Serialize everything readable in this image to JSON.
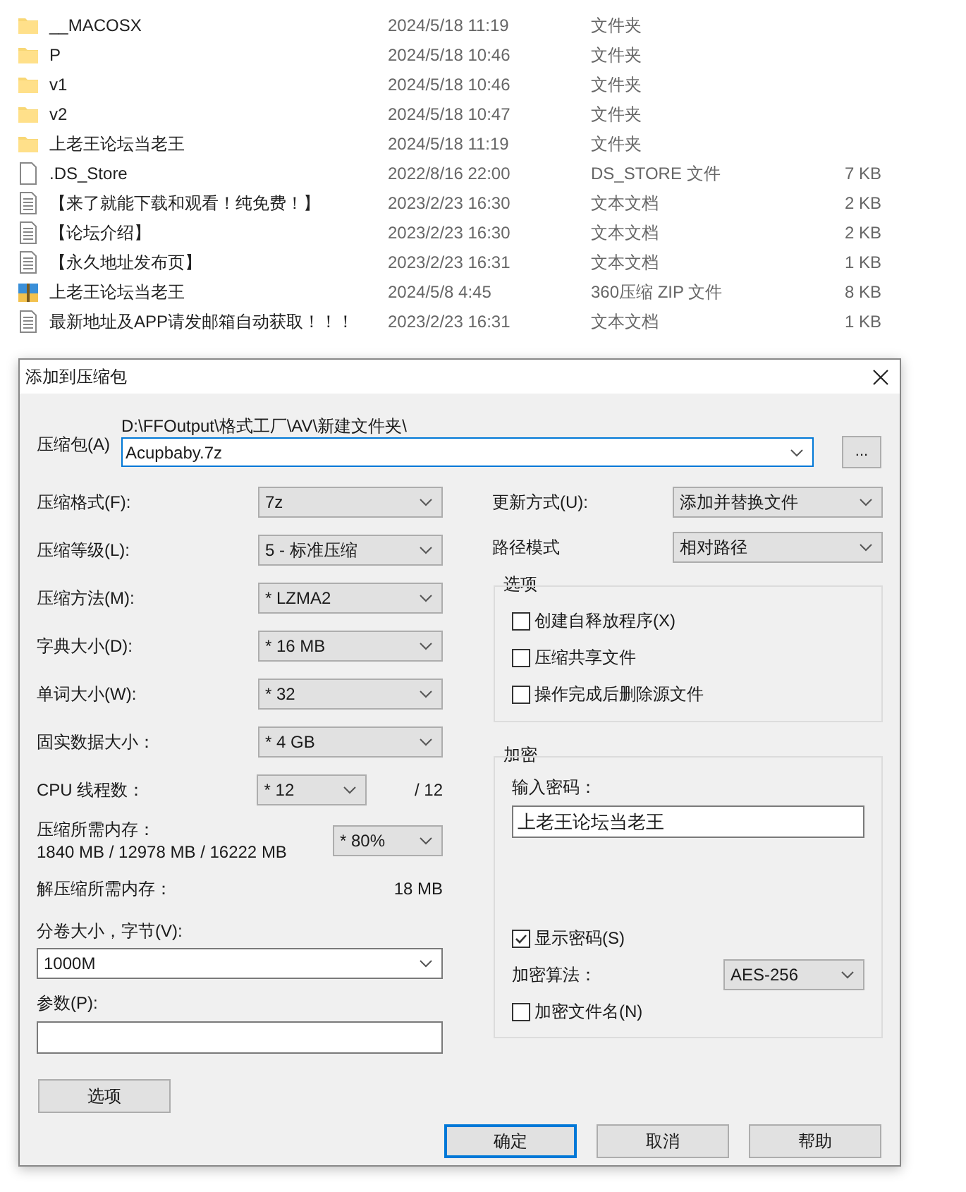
{
  "file_list": {
    "rows": [
      {
        "kind": "folder",
        "name": "__MACOSX",
        "date": "2024/5/18 11:19",
        "type": "文件夹"
      },
      {
        "kind": "folder",
        "name": "P",
        "date": "2024/5/18 10:46",
        "type": "文件夹"
      },
      {
        "kind": "folder",
        "name": "v1",
        "date": "2024/5/18 10:46",
        "type": "文件夹"
      },
      {
        "kind": "folder",
        "name": "v2",
        "date": "2024/5/18 10:47",
        "type": "文件夹"
      },
      {
        "kind": "folder",
        "name": "上老王论坛当老王",
        "date": "2024/5/18 11:19",
        "type": "文件夹"
      },
      {
        "kind": "file",
        "name": ".DS_Store",
        "date": "2022/8/16 22:00",
        "type": "DS_STORE 文件",
        "size": "7 KB"
      },
      {
        "kind": "text",
        "name": "【来了就能下载和观看！纯免费！】",
        "date": "2023/2/23 16:30",
        "type": "文本文档",
        "size": "2 KB"
      },
      {
        "kind": "text",
        "name": "【论坛介绍】",
        "date": "2023/2/23 16:30",
        "type": "文本文档",
        "size": "2 KB"
      },
      {
        "kind": "text",
        "name": "【永久地址发布页】",
        "date": "2023/2/23 16:31",
        "type": "文本文档",
        "size": "1 KB"
      },
      {
        "kind": "zip",
        "name": "上老王论坛当老王",
        "date": "2024/5/8 4:45",
        "type": "360压缩 ZIP 文件",
        "size": "8 KB"
      },
      {
        "kind": "text",
        "name": "最新地址及APP请发邮箱自动获取！！！",
        "date": "2023/2/23 16:31",
        "type": "文本文档",
        "size": "1 KB"
      }
    ]
  },
  "dialog": {
    "title": "添加到压缩包",
    "archive": {
      "label": "压缩包(A)",
      "path": "D:\\FFOutput\\格式工厂\\AV\\新建文件夹\\",
      "value": "Acupbaby.7z",
      "browse": "..."
    },
    "settings": [
      {
        "label": "压缩格式(F):",
        "value": "7z"
      },
      {
        "label": "压缩等级(L):",
        "value": "5 - 标准压缩"
      },
      {
        "label": "压缩方法(M):",
        "value": "*  LZMA2"
      },
      {
        "label": "字典大小(D):",
        "value": "*  16 MB"
      },
      {
        "label": "单词大小(W):",
        "value": "*  32"
      },
      {
        "label": "固实数据大小：",
        "value": "*  4 GB"
      }
    ],
    "threads": {
      "label": "CPU 线程数：",
      "value": "*  12",
      "total": "/ 12"
    },
    "memory": {
      "label": "压缩所需内存：",
      "detail": "1840 MB / 12978 MB / 16222 MB",
      "value": "* 80%"
    },
    "decompress_memory": {
      "label": "解压缩所需内存：",
      "value": "18 MB"
    },
    "volume": {
      "label": "分卷大小，字节(V):",
      "value": "1000M"
    },
    "parameters": {
      "label": "参数(P):"
    },
    "options_button": "选项",
    "update_mode": {
      "label": "更新方式(U):",
      "value": "添加并替换文件"
    },
    "path_mode": {
      "label": "路径模式",
      "value": "相对路径"
    },
    "options": {
      "title": "选项",
      "items": [
        {
          "label": "创建自释放程序(X)",
          "checked": false
        },
        {
          "label": "压缩共享文件",
          "checked": false
        },
        {
          "label": "操作完成后删除源文件",
          "checked": false
        }
      ]
    },
    "encryption": {
      "title": "加密",
      "password_label": "输入密码：",
      "password": "上老王论坛当老王",
      "show_password": {
        "label": "显示密码(S)",
        "checked": true
      },
      "method": {
        "label": "加密算法：",
        "value": "AES-256"
      },
      "encrypt_names": {
        "label": "加密文件名(N)",
        "checked": false
      }
    },
    "buttons": [
      {
        "label": "确定",
        "default": true
      },
      {
        "label": "取消",
        "default": false
      },
      {
        "label": "帮助",
        "default": false
      }
    ]
  }
}
